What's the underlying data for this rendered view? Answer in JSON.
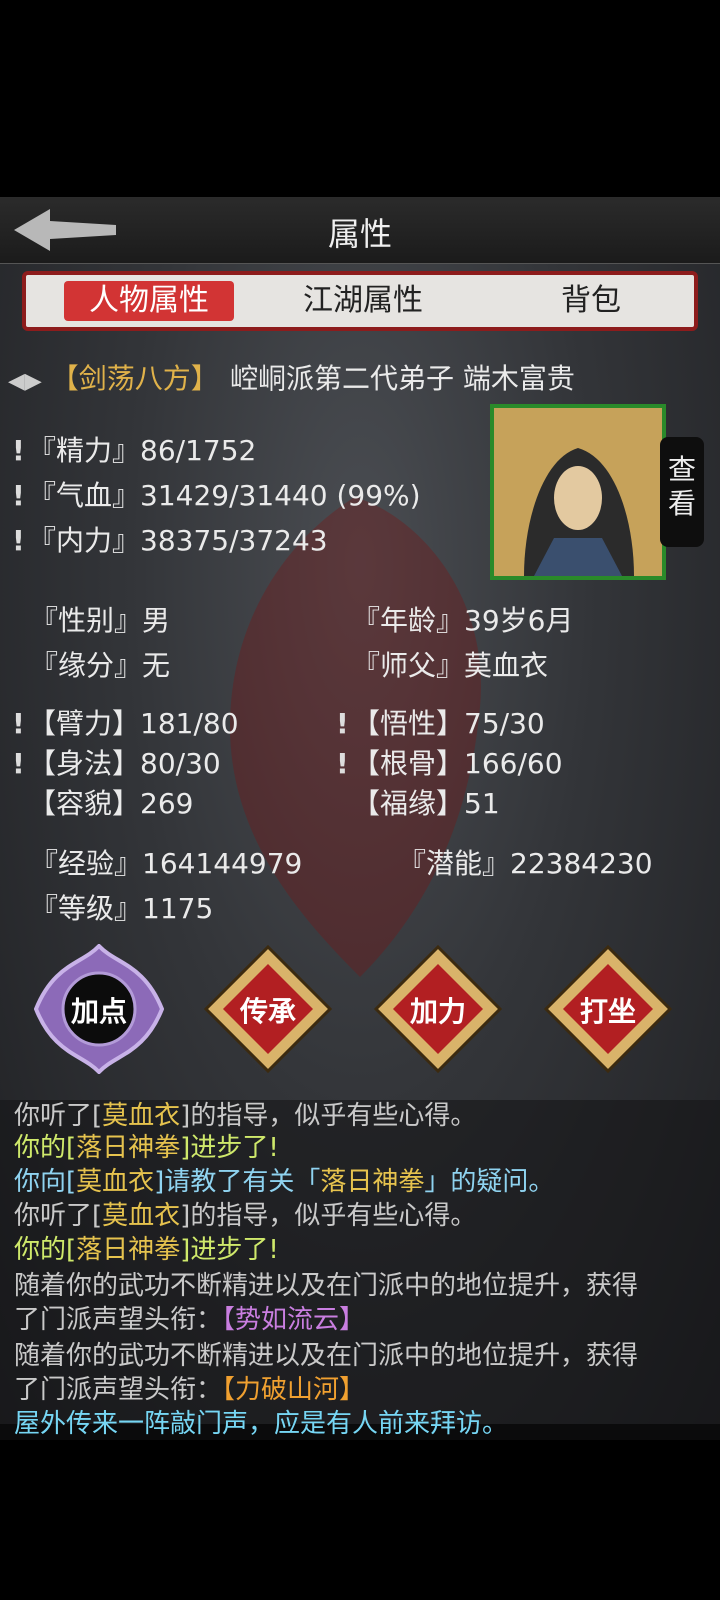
{
  "header": {
    "title": "属性"
  },
  "tabs": [
    {
      "label": "人物属性",
      "active": true
    },
    {
      "label": "江湖属性",
      "active": false
    },
    {
      "label": "背包",
      "active": false
    }
  ],
  "character": {
    "title_badge": "【剑荡八方】",
    "identity": "崆峒派第二代弟子 端木富贵",
    "view_button": "查看"
  },
  "vitals": [
    {
      "label": "『精力』",
      "value": "86/1752"
    },
    {
      "label": "『气血』",
      "value": "31429/31440 (99%)"
    },
    {
      "label": "『内力』",
      "value": "38375/37243"
    }
  ],
  "info": {
    "gender_label": "『性别』",
    "gender": "男",
    "age_label": "『年龄』",
    "age": "39岁6月",
    "fate_label": "『缘分』",
    "fate": "无",
    "master_label": "『师父』",
    "master": "莫血衣"
  },
  "attributes": {
    "arm_label": "【臂力】",
    "arm": "181/80",
    "wit_label": "【悟性】",
    "wit": "75/30",
    "agility_label": "【身法】",
    "agility": "80/30",
    "bone_label": "【根骨】",
    "bone": "166/60",
    "looks_label": "【容貌】",
    "looks": "269",
    "luck_label": "【福缘】",
    "luck": "51"
  },
  "progress": {
    "exp_label": "『经验』",
    "exp": "164144979",
    "potential_label": "『潜能』",
    "potential": "22384230",
    "level_label": "『等级』",
    "level": "1175"
  },
  "actions": [
    "加点",
    "传承",
    "加力",
    "打坐"
  ],
  "log": {
    "l1": {
      "pre": "你听了[",
      "hl": "莫血衣",
      "post": "]的指导，似乎有些心得。"
    },
    "l2": {
      "pre": "你的[",
      "hl": "落日神拳",
      "post": "]进步了!"
    },
    "l3": {
      "pre": "你向[",
      "hl": "莫血衣",
      "mid": "]请教了有关「",
      "hl2": "落日神拳",
      "post": "」的疑问。"
    },
    "l4": {
      "pre": "你听了[",
      "hl": "莫血衣",
      "post": "]的指导，似乎有些心得。"
    },
    "l5": {
      "pre": "你的[",
      "hl": "落日神拳",
      "post": "]进步了!"
    },
    "l6": {
      "text": "随着你的武功不断精进以及在门派中的地位提升，获得"
    },
    "l7": {
      "pre": "了门派声望头衔：",
      "hl": "【势如流云】"
    },
    "l8": {
      "text": "随着你的武功不断精进以及在门派中的地位提升，获得"
    },
    "l9": {
      "pre": "了门派声望头衔：",
      "hl": "【力破山河】"
    },
    "l10": {
      "text": "屋外传来一阵敲门声，应是有人前来拜访。"
    }
  },
  "colors": {
    "tab_active": "#d23434",
    "frame_red": "#8d1c1c",
    "portrait_border": "#2a8a2a",
    "log_green": "#cfe96b",
    "log_cyan": "#8fd3f0"
  }
}
